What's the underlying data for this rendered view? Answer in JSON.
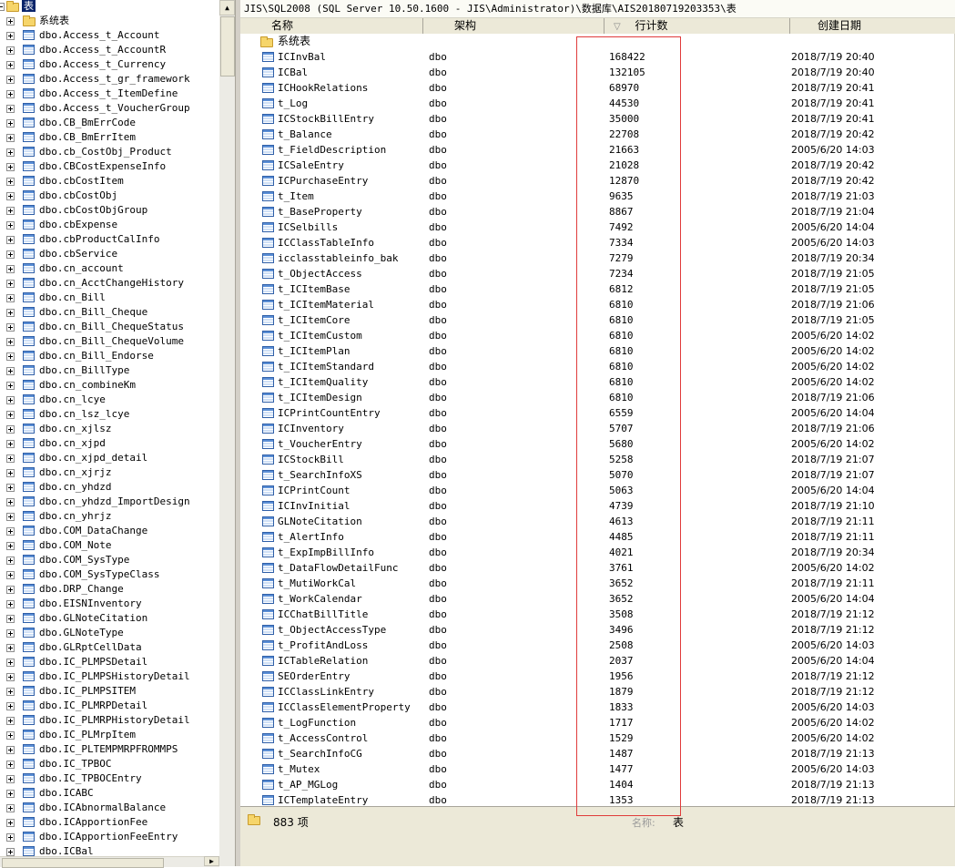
{
  "tree": {
    "root_label": "表",
    "system_folder": "系统表",
    "items": [
      "dbo.Access_t_Account",
      "dbo.Access_t_AccountR",
      "dbo.Access_t_Currency",
      "dbo.Access_t_gr_framework",
      "dbo.Access_t_ItemDefine",
      "dbo.Access_t_VoucherGroup",
      "dbo.CB_BmErrCode",
      "dbo.CB_BmErrItem",
      "dbo.cb_CostObj_Product",
      "dbo.CBCostExpenseInfo",
      "dbo.cbCostItem",
      "dbo.cbCostObj",
      "dbo.cbCostObjGroup",
      "dbo.cbExpense",
      "dbo.cbProductCalInfo",
      "dbo.cbService",
      "dbo.cn_account",
      "dbo.cn_AcctChangeHistory",
      "dbo.cn_Bill",
      "dbo.cn_Bill_Cheque",
      "dbo.cn_Bill_ChequeStatus",
      "dbo.cn_Bill_ChequeVolume",
      "dbo.cn_Bill_Endorse",
      "dbo.cn_BillType",
      "dbo.cn_combineKm",
      "dbo.cn_lcye",
      "dbo.cn_lsz_lcye",
      "dbo.cn_xjlsz",
      "dbo.cn_xjpd",
      "dbo.cn_xjpd_detail",
      "dbo.cn_xjrjz",
      "dbo.cn_yhdzd",
      "dbo.cn_yhdzd_ImportDesign",
      "dbo.cn_yhrjz",
      "dbo.COM_DataChange",
      "dbo.COM_Note",
      "dbo.COM_SysType",
      "dbo.COM_SysTypeClass",
      "dbo.DRP_Change",
      "dbo.EISNInventory",
      "dbo.GLNoteCitation",
      "dbo.GLNoteType",
      "dbo.GLRptCellData",
      "dbo.IC_PLMPSDetail",
      "dbo.IC_PLMPSHistoryDetail",
      "dbo.IC_PLMPSITEM",
      "dbo.IC_PLMRPDetail",
      "dbo.IC_PLMRPHistoryDetail",
      "dbo.IC_PLMrpItem",
      "dbo.IC_PLTEMPMRPFROMMPS",
      "dbo.IC_TPBOC",
      "dbo.IC_TPBOCEntry",
      "dbo.ICABC",
      "dbo.ICAbnormalBalance",
      "dbo.ICApportionFee",
      "dbo.ICApportionFeeEntry",
      "dbo.ICBal"
    ]
  },
  "breadcrumb": "JIS\\SQL2008 (SQL Server 10.50.1600 - JIS\\Administrator)\\数据库\\AIS20180719203353\\表",
  "columns": {
    "name": "名称",
    "schema": "架构",
    "rowcount": "行计数",
    "created": "创建日期",
    "sort_indicator": "▽"
  },
  "system_folder_row": "系统表",
  "rows": [
    {
      "name": "ICInvBal",
      "schema": "dbo",
      "count": "168422",
      "date": "2018/7/19 20:40"
    },
    {
      "name": "ICBal",
      "schema": "dbo",
      "count": "132105",
      "date": "2018/7/19 20:40"
    },
    {
      "name": "ICHookRelations",
      "schema": "dbo",
      "count": "68970",
      "date": "2018/7/19 20:41"
    },
    {
      "name": "t_Log",
      "schema": "dbo",
      "count": "44530",
      "date": "2018/7/19 20:41"
    },
    {
      "name": "ICStockBillEntry",
      "schema": "dbo",
      "count": "35000",
      "date": "2018/7/19 20:41"
    },
    {
      "name": "t_Balance",
      "schema": "dbo",
      "count": "22708",
      "date": "2018/7/19 20:42"
    },
    {
      "name": "t_FieldDescription",
      "schema": "dbo",
      "count": "21663",
      "date": "2005/6/20 14:03"
    },
    {
      "name": "ICSaleEntry",
      "schema": "dbo",
      "count": "21028",
      "date": "2018/7/19 20:42"
    },
    {
      "name": "ICPurchaseEntry",
      "schema": "dbo",
      "count": "12870",
      "date": "2018/7/19 20:42"
    },
    {
      "name": "t_Item",
      "schema": "dbo",
      "count": "9635",
      "date": "2018/7/19 21:03"
    },
    {
      "name": "t_BaseProperty",
      "schema": "dbo",
      "count": "8867",
      "date": "2018/7/19 21:04"
    },
    {
      "name": "ICSelbills",
      "schema": "dbo",
      "count": "7492",
      "date": "2005/6/20 14:04"
    },
    {
      "name": "ICClassTableInfo",
      "schema": "dbo",
      "count": "7334",
      "date": "2005/6/20 14:03"
    },
    {
      "name": "icclasstableinfo_bak",
      "schema": "dbo",
      "count": "7279",
      "date": "2018/7/19 20:34"
    },
    {
      "name": "t_ObjectAccess",
      "schema": "dbo",
      "count": "7234",
      "date": "2018/7/19 21:05"
    },
    {
      "name": "t_ICItemBase",
      "schema": "dbo",
      "count": "6812",
      "date": "2018/7/19 21:05"
    },
    {
      "name": "t_ICItemMaterial",
      "schema": "dbo",
      "count": "6810",
      "date": "2018/7/19 21:06"
    },
    {
      "name": "t_ICItemCore",
      "schema": "dbo",
      "count": "6810",
      "date": "2018/7/19 21:05"
    },
    {
      "name": "t_ICItemCustom",
      "schema": "dbo",
      "count": "6810",
      "date": "2005/6/20 14:02"
    },
    {
      "name": "t_ICItemPlan",
      "schema": "dbo",
      "count": "6810",
      "date": "2005/6/20 14:02"
    },
    {
      "name": "t_ICItemStandard",
      "schema": "dbo",
      "count": "6810",
      "date": "2005/6/20 14:02"
    },
    {
      "name": "t_ICItemQuality",
      "schema": "dbo",
      "count": "6810",
      "date": "2005/6/20 14:02"
    },
    {
      "name": "t_ICItemDesign",
      "schema": "dbo",
      "count": "6810",
      "date": "2018/7/19 21:06"
    },
    {
      "name": "ICPrintCountEntry",
      "schema": "dbo",
      "count": "6559",
      "date": "2005/6/20 14:04"
    },
    {
      "name": "ICInventory",
      "schema": "dbo",
      "count": "5707",
      "date": "2018/7/19 21:06"
    },
    {
      "name": "t_VoucherEntry",
      "schema": "dbo",
      "count": "5680",
      "date": "2005/6/20 14:02"
    },
    {
      "name": "ICStockBill",
      "schema": "dbo",
      "count": "5258",
      "date": "2018/7/19 21:07"
    },
    {
      "name": "t_SearchInfoXS",
      "schema": "dbo",
      "count": "5070",
      "date": "2018/7/19 21:07"
    },
    {
      "name": "ICPrintCount",
      "schema": "dbo",
      "count": "5063",
      "date": "2005/6/20 14:04"
    },
    {
      "name": "ICInvInitial",
      "schema": "dbo",
      "count": "4739",
      "date": "2018/7/19 21:10"
    },
    {
      "name": "GLNoteCitation",
      "schema": "dbo",
      "count": "4613",
      "date": "2018/7/19 21:11"
    },
    {
      "name": "t_AlertInfo",
      "schema": "dbo",
      "count": "4485",
      "date": "2018/7/19 21:11"
    },
    {
      "name": "t_ExpImpBillInfo",
      "schema": "dbo",
      "count": "4021",
      "date": "2018/7/19 20:34"
    },
    {
      "name": "t_DataFlowDetailFunc",
      "schema": "dbo",
      "count": "3761",
      "date": "2005/6/20 14:02"
    },
    {
      "name": "t_MutiWorkCal",
      "schema": "dbo",
      "count": "3652",
      "date": "2018/7/19 21:11"
    },
    {
      "name": "t_WorkCalendar",
      "schema": "dbo",
      "count": "3652",
      "date": "2005/6/20 14:04"
    },
    {
      "name": "ICChatBillTitle",
      "schema": "dbo",
      "count": "3508",
      "date": "2018/7/19 21:12"
    },
    {
      "name": "t_ObjectAccessType",
      "schema": "dbo",
      "count": "3496",
      "date": "2018/7/19 21:12"
    },
    {
      "name": "t_ProfitAndLoss",
      "schema": "dbo",
      "count": "2508",
      "date": "2005/6/20 14:03"
    },
    {
      "name": "ICTableRelation",
      "schema": "dbo",
      "count": "2037",
      "date": "2005/6/20 14:04"
    },
    {
      "name": "SEOrderEntry",
      "schema": "dbo",
      "count": "1956",
      "date": "2018/7/19 21:12"
    },
    {
      "name": "ICClassLinkEntry",
      "schema": "dbo",
      "count": "1879",
      "date": "2018/7/19 21:12"
    },
    {
      "name": "ICClassElementProperty",
      "schema": "dbo",
      "count": "1833",
      "date": "2005/6/20 14:03"
    },
    {
      "name": "t_LogFunction",
      "schema": "dbo",
      "count": "1717",
      "date": "2005/6/20 14:02"
    },
    {
      "name": "t_AccessControl",
      "schema": "dbo",
      "count": "1529",
      "date": "2005/6/20 14:02"
    },
    {
      "name": "t_SearchInfoCG",
      "schema": "dbo",
      "count": "1487",
      "date": "2018/7/19 21:13"
    },
    {
      "name": "t_Mutex",
      "schema": "dbo",
      "count": "1477",
      "date": "2005/6/20 14:03"
    },
    {
      "name": "t_AP_MGLog",
      "schema": "dbo",
      "count": "1404",
      "date": "2018/7/19 21:13"
    },
    {
      "name": "ICTemplateEntry",
      "schema": "dbo",
      "count": "1353",
      "date": "2018/7/19 21:13"
    }
  ],
  "status": {
    "count_text": "883 项",
    "name_label": "名称:",
    "name_value": "表"
  },
  "colors": {
    "selection": "#0a246a",
    "highlight_box": "#e03b3b",
    "chrome": "#ece9d8"
  }
}
